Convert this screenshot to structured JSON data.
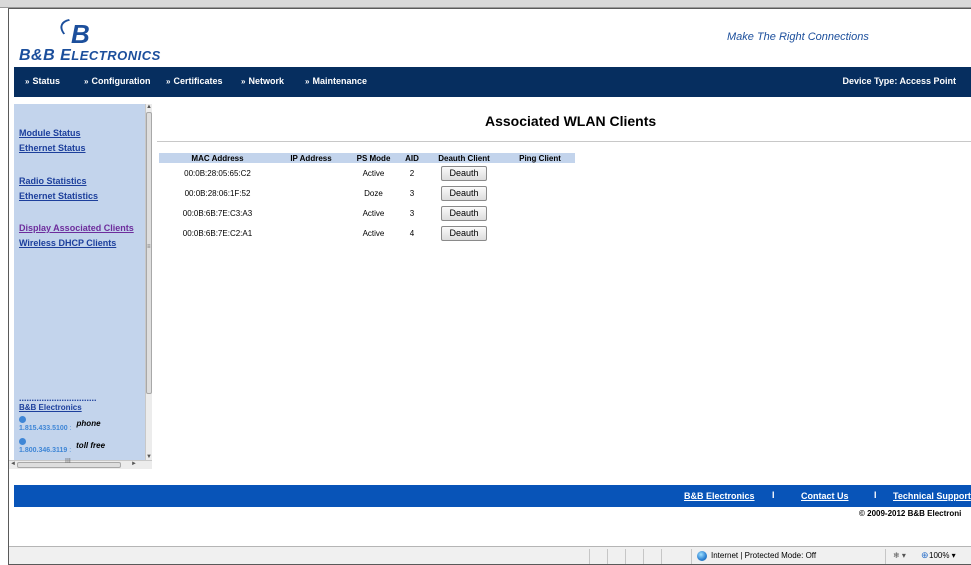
{
  "brand": {
    "logo_mark": "B",
    "logo_name_lead": "B&B",
    "logo_name_e": "E",
    "logo_name_rest": "LECTRONICS",
    "tagline": "Make The Right Connections"
  },
  "nav": {
    "items": [
      {
        "label": "Status"
      },
      {
        "label": "Configuration"
      },
      {
        "label": "Certificates"
      },
      {
        "label": "Network"
      },
      {
        "label": "Maintenance"
      }
    ],
    "chevron": "»",
    "device_type": "Device Type: Access Point"
  },
  "sidebar": {
    "links": [
      {
        "label": "Module Status"
      },
      {
        "label": "Ethernet Status"
      },
      {
        "label": "Radio Statistics"
      },
      {
        "label": "Ethernet Statistics"
      },
      {
        "label": "Display Associated Clients"
      },
      {
        "label": "Wireless DHCP Clients"
      }
    ],
    "dots": "...............................",
    "company": "B&B Electronics",
    "phone_number": "1.815.433.5100",
    "phone_sep": ":",
    "phone_label": "phone",
    "tollfree_number": "1.800.346.3119",
    "tollfree_sep": ":",
    "tollfree_label": "toll free",
    "scroll_grip": "≡",
    "hscroll_grip": "III",
    "arrow_up": "▲",
    "arrow_down": "▼",
    "arrow_left": "◄",
    "arrow_right": "►"
  },
  "main": {
    "title": "Associated WLAN Clients",
    "columns": [
      "MAC Address",
      "IP Address",
      "PS Mode",
      "AID",
      "Deauth Client",
      "Ping Client"
    ],
    "button_label": "Deauth",
    "rows": [
      {
        "mac": "00:0B:28:05:65:C2",
        "ip": "",
        "ps_mode": "Active",
        "aid": "2"
      },
      {
        "mac": "00:0B:28:06:1F:52",
        "ip": "",
        "ps_mode": "Doze",
        "aid": "3"
      },
      {
        "mac": "00:0B:6B:7E:C3:A3",
        "ip": "",
        "ps_mode": "Active",
        "aid": "3"
      },
      {
        "mac": "00:0B:6B:7E:C2:A1",
        "ip": "",
        "ps_mode": "Active",
        "aid": "4"
      }
    ]
  },
  "footer": {
    "links": [
      "B&B Electronics",
      "Contact Us",
      "Technical Support"
    ],
    "separator": "I",
    "copyright": "© 2009-2012 B&B Electroni"
  },
  "statusbar": {
    "zone": "Internet | Protected Mode: Off",
    "protected_icon": "❄ ▾",
    "zoom_icon": "⊕",
    "zoom": "100%  ▾"
  },
  "colors": {
    "nav_bg": "#062e5f",
    "sidebar_bg": "#c3d4ec",
    "footer_bg": "#0854b8",
    "brand_blue": "#1c4f9c"
  }
}
